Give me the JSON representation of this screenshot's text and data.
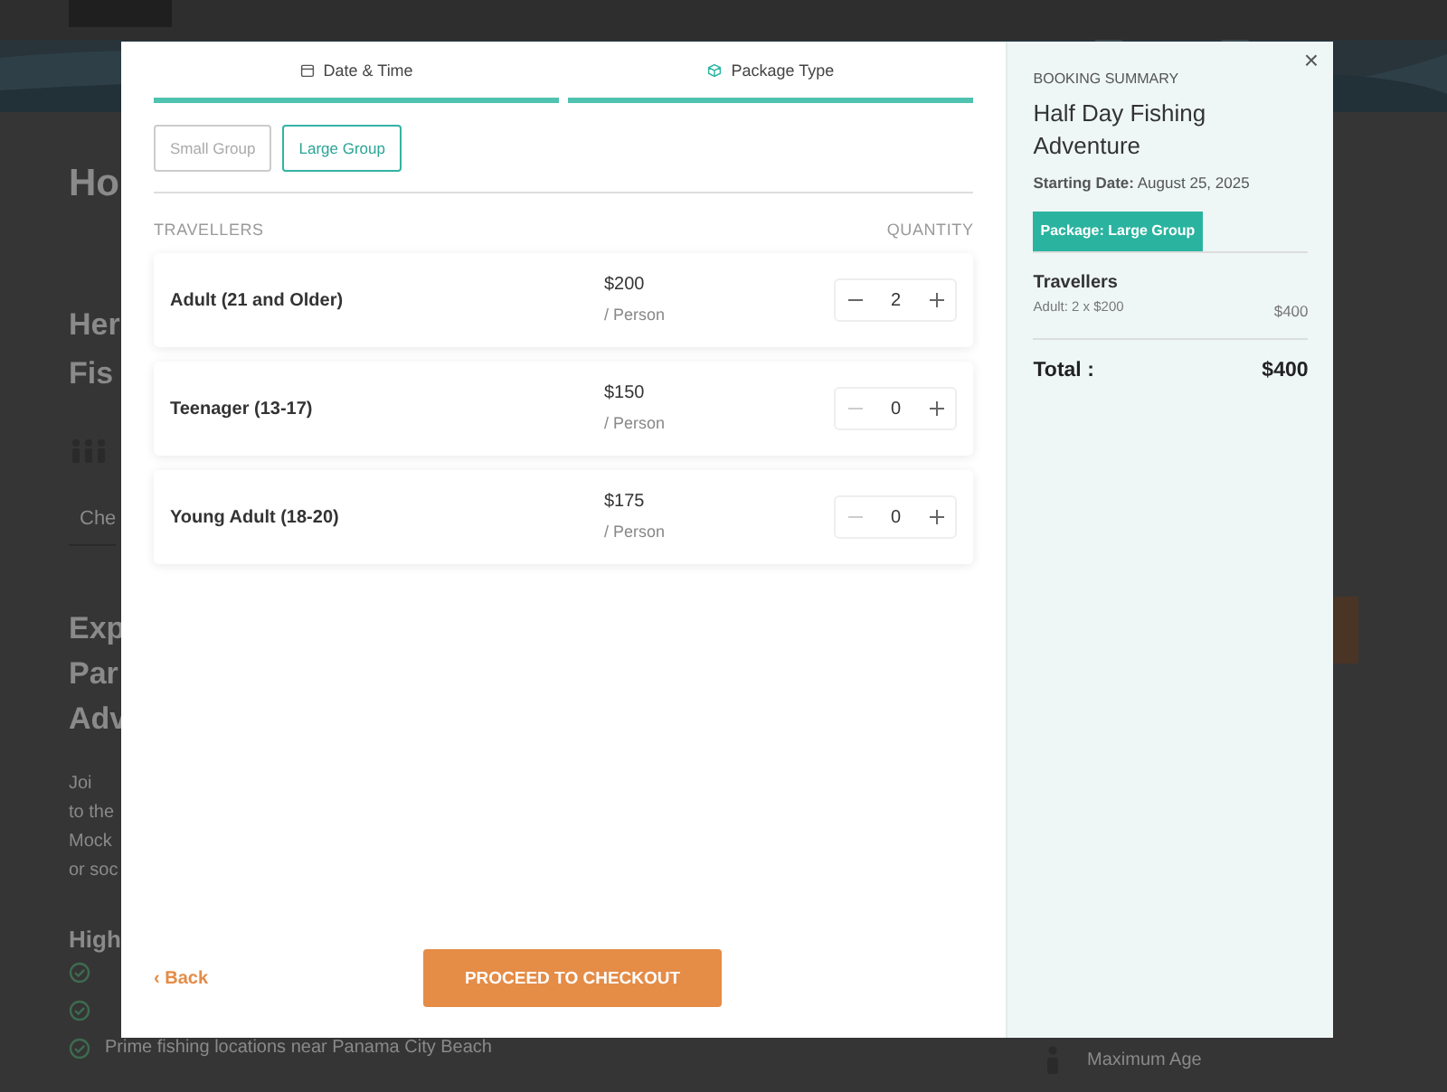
{
  "background_page": {
    "heading_fragment": "Ho",
    "title_fragments": [
      "Her",
      "Fis"
    ],
    "tab_fragment": "Che",
    "section_fragments": [
      "Exp",
      "Par",
      "Adv"
    ],
    "paragraph_fragments": [
      "Joi",
      "to the",
      "Mock",
      "or soc"
    ],
    "highlights_fragment": "High",
    "highlights": [
      "Prime fishing locations near Panama City Beach"
    ],
    "side_label": "Maximum Age"
  },
  "modal": {
    "steps": [
      {
        "kind": "date",
        "label": "Date & Time",
        "completed": true
      },
      {
        "kind": "package",
        "label": "Package Type",
        "completed": true
      }
    ],
    "packages": [
      {
        "label": "Small Group",
        "selected": false
      },
      {
        "label": "Large Group",
        "selected": true
      }
    ],
    "travellers_header": "TRAVELLERS",
    "quantity_header": "QUANTITY",
    "travellers": [
      {
        "name": "Adult (21 and Older)",
        "price": "$200",
        "unit": "/ Person",
        "quantity": "2",
        "minus_disabled": false
      },
      {
        "name": "Teenager (13-17)",
        "price": "$150",
        "unit": "/ Person",
        "quantity": "0",
        "minus_disabled": true
      },
      {
        "name": "Young Adult (18-20)",
        "price": "$175",
        "unit": "/ Person",
        "quantity": "0",
        "minus_disabled": true
      }
    ],
    "back": {
      "icon": "‹",
      "label": "Back"
    },
    "proceed": "PROCEED TO CHECKOUT",
    "summary": {
      "close": "×",
      "heading": "BOOKING SUMMARY",
      "title": "Half Day Fishing Adventure",
      "starting_date": "**Starting Date:** August 25, 2025",
      "package_badge": "Package: Large Group",
      "travellers_heading": "Travellers",
      "lines": [
        {
          "label": "Adult: 2 x $200",
          "amount": "$400"
        }
      ],
      "total_label": "Total :",
      "total_value": "$400"
    }
  }
}
